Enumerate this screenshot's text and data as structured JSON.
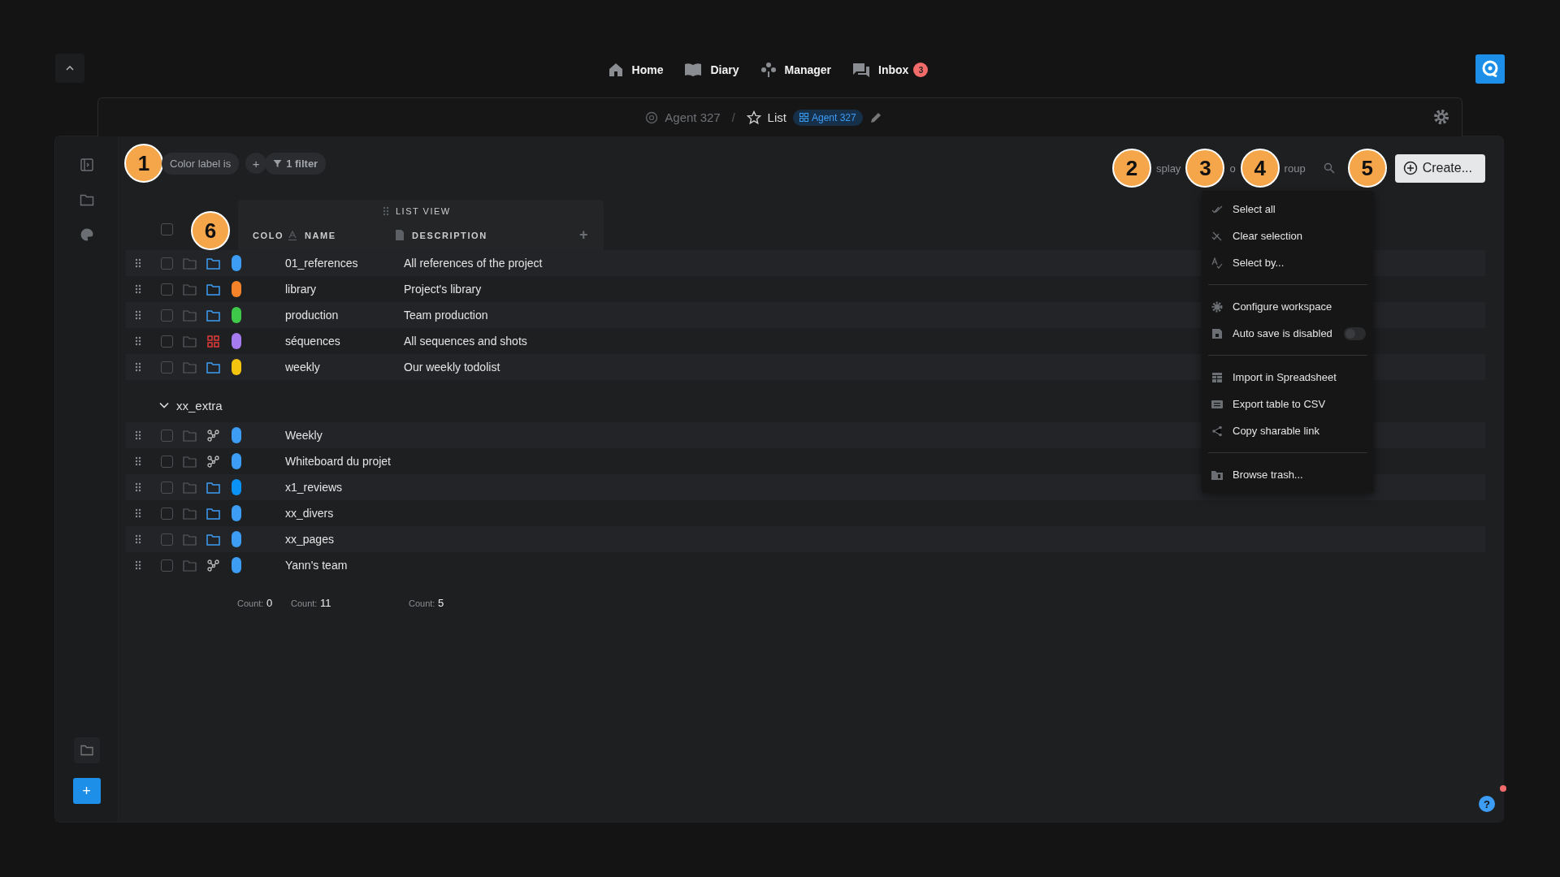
{
  "nav": {
    "items": [
      {
        "label": "Home",
        "kind": "home"
      },
      {
        "label": "Diary",
        "kind": "diary"
      },
      {
        "label": "Manager",
        "kind": "manager"
      },
      {
        "label": "Inbox",
        "kind": "inbox",
        "badge": "3"
      }
    ]
  },
  "breadcrumb": {
    "workspace": "Agent 327",
    "separator": "/",
    "view_name": "List",
    "tag": "Agent 327"
  },
  "callouts": [
    "1",
    "2",
    "3",
    "4",
    "5",
    "6"
  ],
  "toolbar": {
    "filter_chip": "Color label is",
    "add": "+",
    "filter_count": "1 filter",
    "view_controls": [
      "splay",
      "o",
      "roup"
    ],
    "create": "Create..."
  },
  "table": {
    "group_header": "LIST VIEW",
    "columns": [
      "COLO",
      "NAME",
      "DESCRIPTION"
    ],
    "add_column": "+",
    "select_all": {
      "checked": false
    },
    "rows": [
      {
        "name": "01_references",
        "description": "All references of the project",
        "kind": "folder",
        "color": "#3d9df5",
        "checked": false
      },
      {
        "name": "library",
        "description": "Project's library",
        "kind": "folder",
        "color": "#f5832a",
        "checked": false
      },
      {
        "name": "production",
        "description": "Team production",
        "kind": "folder",
        "color": "#3ec94a",
        "checked": false
      },
      {
        "name": "séquences",
        "description": "All sequences and shots",
        "kind": "board",
        "color": "#a77bf0",
        "checked": false
      },
      {
        "name": "weekly",
        "description": "Our weekly todolist",
        "kind": "folder",
        "color": "#f5c40f",
        "checked": false
      }
    ],
    "group": {
      "name": "xx_extra",
      "expanded": true,
      "rows": [
        {
          "name": "Weekly",
          "kind": "whiteboard",
          "color": "#3d9df5",
          "checked": false
        },
        {
          "name": "Whiteboard du projet",
          "kind": "whiteboard",
          "color": "#3d9df5",
          "checked": false
        },
        {
          "name": "x1_reviews",
          "kind": "folder",
          "color": "#0a93f5",
          "checked": false
        },
        {
          "name": "xx_divers",
          "kind": "folder",
          "color": "#3d9df5",
          "checked": false
        },
        {
          "name": "xx_pages",
          "kind": "folder",
          "color": "#3d9df5",
          "checked": false
        },
        {
          "name": "Yann's team",
          "kind": "whiteboard",
          "color": "#3d9df5",
          "checked": false
        }
      ]
    },
    "counts": [
      {
        "label": "Count:",
        "value": "0"
      },
      {
        "label": "Count:",
        "value": "11"
      },
      {
        "label": "Count:",
        "value": "5"
      }
    ]
  },
  "menu": {
    "items": [
      {
        "kind": "item",
        "label": "Select all"
      },
      {
        "kind": "item",
        "label": "Clear selection"
      },
      {
        "kind": "item",
        "label": "Select by..."
      },
      {
        "kind": "divider"
      },
      {
        "kind": "item",
        "label": "Configure workspace"
      },
      {
        "kind": "toggle",
        "label": "Auto save is disabled",
        "on": false
      },
      {
        "kind": "divider"
      },
      {
        "kind": "item",
        "label": "Import in Spreadsheet"
      },
      {
        "kind": "item",
        "label": "Export table to CSV"
      },
      {
        "kind": "item",
        "label": "Copy sharable link"
      },
      {
        "kind": "divider"
      },
      {
        "kind": "item",
        "label": "Browse trash..."
      }
    ]
  },
  "help": {
    "label": "?",
    "notification": true
  }
}
